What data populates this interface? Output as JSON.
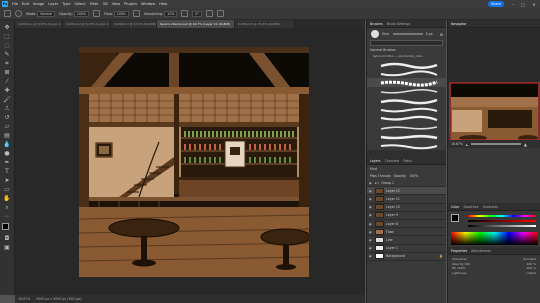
{
  "menubar": {
    "items": [
      "File",
      "Edit",
      "Image",
      "Layer",
      "Type",
      "Select",
      "Filter",
      "3D",
      "View",
      "Plugins",
      "Window",
      "Help"
    ],
    "share": "Share"
  },
  "options": {
    "mode_label": "Mode:",
    "mode_value": "Normal",
    "opacity_label": "Opacity:",
    "opacity_value": "100%",
    "flow_label": "Flow:",
    "flow_value": "100%",
    "smoothing_label": "Smoothing:",
    "smoothing_value": "10%",
    "angle_value": "0°"
  },
  "tabs": [
    "Untitled-1 @ 6.67% (Layer 1, RGB/8)",
    "Untitled-2 @ 8.33% (Layer 2, RGB/8)",
    "Untitled-3 @ 12.5% (RGB/8)",
    "tavern-interior.psd @ 16.7% (Layer 12, RGB/8)",
    "Untitled-5 @ 33.3% (RGB/8)"
  ],
  "active_tab": 3,
  "status": {
    "zoom": "16.67%",
    "info": "3000 px x 3000 px (300 ppi)"
  },
  "brushes": {
    "tab1": "Brushes",
    "tab2": "Brush Settings",
    "size_label": "Size:",
    "size_value": "4 px",
    "group": "General Brushes",
    "subgroup": "Kyle's Ink Box — photoshop_inks..."
  },
  "layers": {
    "tab1": "Layers",
    "tab2": "Channels",
    "tab3": "Paths",
    "kind": "Kind",
    "blend": "Pass Through",
    "opacity_label": "Opacity:",
    "opacity_value": "100%",
    "rows": [
      {
        "name": "Group 1",
        "kind": "group"
      },
      {
        "name": "Layer 12",
        "kind": "layer"
      },
      {
        "name": "Layer 11",
        "kind": "layer"
      },
      {
        "name": "Layer 10",
        "kind": "layer"
      },
      {
        "name": "Layer 9",
        "kind": "layer"
      },
      {
        "name": "Layer 8",
        "kind": "layer"
      },
      {
        "name": "Floor",
        "kind": "layer"
      },
      {
        "name": "Line",
        "kind": "layer"
      },
      {
        "name": "Layer 1",
        "kind": "layer"
      },
      {
        "name": "Background",
        "kind": "layer"
      }
    ]
  },
  "navigator": {
    "title": "Navigator",
    "zoom": "16.67%"
  },
  "color": {
    "tab1": "Color",
    "tab2": "Swatches",
    "tab3": "Gradients"
  },
  "properties": {
    "tab1": "Properties",
    "tab2": "Adjustments",
    "rows": [
      {
        "label": "Character",
        "value": "Unlinked"
      },
      {
        "label": "Opacity 100",
        "value": "100 %"
      },
      {
        "label": "Fill 100%",
        "value": "100 %"
      },
      {
        "label": "Lightness",
        "value": "Linked"
      }
    ]
  }
}
